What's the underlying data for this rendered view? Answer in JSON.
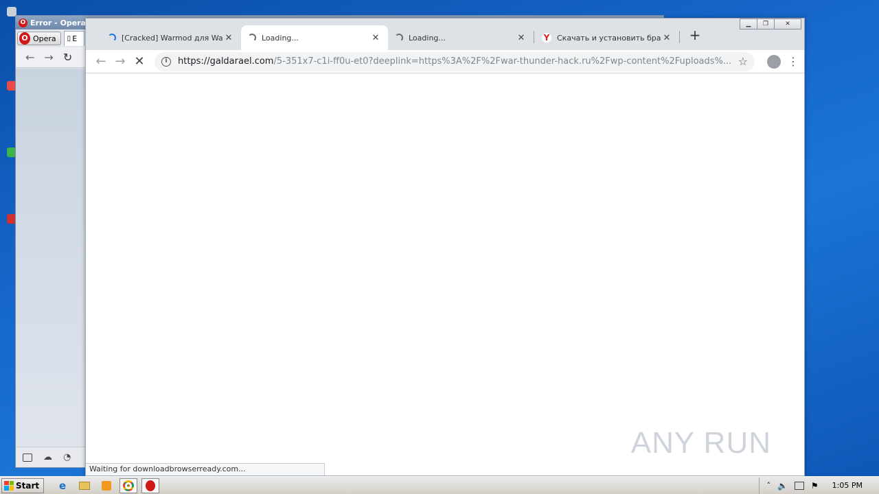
{
  "opera": {
    "title": "Error - Opera",
    "menu_label": "Opera",
    "tab_label": "E"
  },
  "chrome": {
    "tabs": [
      {
        "title": "[Cracked] Warmod для War Th",
        "state": "loading-blue"
      },
      {
        "title": "Loading...",
        "state": "loading"
      },
      {
        "title": "Loading...",
        "state": "loading"
      },
      {
        "title": "Скачать и установить брауз",
        "state": "yandex"
      }
    ],
    "url_host": "https://galdarael.com",
    "url_path": "/5-351x7-c1i-ff0u-et0?deeplink=https%3A%2F%2Fwar-thunder-hack.ru%2Fwp-content%2Fuploads%...",
    "status_text": "Waiting for downloadbrowserready.com..."
  },
  "watermark": "ANY RUN",
  "taskbar": {
    "start_label": "Start",
    "clock": "1:05 PM"
  }
}
